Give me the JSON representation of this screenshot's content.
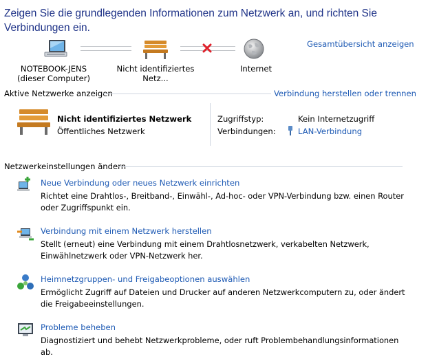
{
  "title": "Zeigen Sie die grundlegenden Informationen zum Netzwerk an, und richten Sie Verbindungen ein.",
  "overview_link": "Gesamtübersicht anzeigen",
  "map": {
    "computer_name": "NOTEBOOK-JENS",
    "computer_sub": "(dieser Computer)",
    "network_label": "Nicht identifiziertes Netz...",
    "internet_label": "Internet"
  },
  "active": {
    "section_label": "Aktive Netzwerke anzeigen",
    "connect_link": "Verbindung herstellen oder trennen",
    "network_name": "Nicht identifiziertes Netzwerk",
    "network_type": "Öffentliches Netzwerk",
    "access_label": "Zugriffstyp:",
    "access_value": "Kein Internetzugriff",
    "connections_label": "Verbindungen:",
    "connection_value": "LAN-Verbindung"
  },
  "settings": {
    "section_label": "Netzwerkeinstellungen ändern",
    "items": [
      {
        "label": "Neue Verbindung oder neues Netzwerk einrichten",
        "desc": "Richtet eine Drahtlos-, Breitband-, Einwähl-, Ad-hoc- oder VPN-Verbindung bzw. einen Router oder Zugriffspunkt ein.",
        "icon": "new-connection-icon"
      },
      {
        "label": "Verbindung mit einem Netzwerk herstellen",
        "desc": "Stellt (erneut) eine Verbindung mit einem Drahtlosnetzwerk, verkabelten Netzwerk, Einwählnetzwerk oder VPN-Netzwerk her.",
        "icon": "connect-network-icon"
      },
      {
        "label": "Heimnetzgruppen- und Freigabeoptionen auswählen",
        "desc": "Ermöglicht Zugriff auf Dateien und Drucker auf anderen Netzwerkcomputern zu, oder ändert die Freigabeeinstellungen.",
        "icon": "homegroup-icon"
      },
      {
        "label": "Probleme beheben",
        "desc": "Diagnostiziert und behebt Netzwerkprobleme, oder ruft Problembehandlungsinformationen ab.",
        "icon": "troubleshoot-icon"
      }
    ]
  },
  "colors": {
    "link": "#1e5ab4",
    "title": "#1e3287",
    "error_x": "#e0202a"
  }
}
